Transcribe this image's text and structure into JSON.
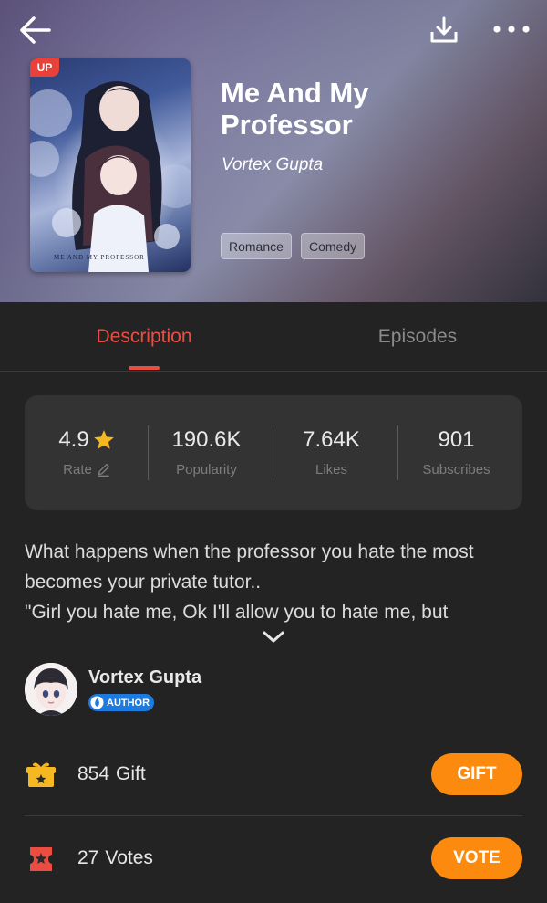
{
  "header": {
    "back_icon": "arrow-left-icon",
    "download_icon": "download-icon",
    "more_icon": "more-dots-icon"
  },
  "book": {
    "badge": "UP",
    "cover_caption": "ME AND MY PROFESSOR",
    "title": "Me And My Professor",
    "author": "Vortex Gupta",
    "tags": [
      "Romance",
      "Comedy"
    ]
  },
  "tabs": {
    "description": "Description",
    "episodes": "Episodes"
  },
  "stats": {
    "rate": {
      "value": "4.9",
      "label": "Rate"
    },
    "popularity": {
      "value": "190.6K",
      "label": "Popularity"
    },
    "likes": {
      "value": "7.64K",
      "label": "Likes"
    },
    "subscribes": {
      "value": "901",
      "label": "Subscribes"
    }
  },
  "description": {
    "line1": "What happens when the professor you hate the most",
    "line2": "becomes your private tutor..",
    "line3": "\"Girl you hate me, Ok I'll allow you to hate me, but"
  },
  "author_section": {
    "name": "Vortex Gupta",
    "badge": "AUTHOR"
  },
  "gift": {
    "count": "854",
    "label": "Gift",
    "button": "GIFT"
  },
  "votes": {
    "count": "27",
    "label": "Votes",
    "button": "VOTE"
  },
  "colors": {
    "accent_red": "#ec4d43",
    "button_orange": "#fb8a0e",
    "star_gold": "#f5b820",
    "author_blue": "#1d7be0"
  }
}
